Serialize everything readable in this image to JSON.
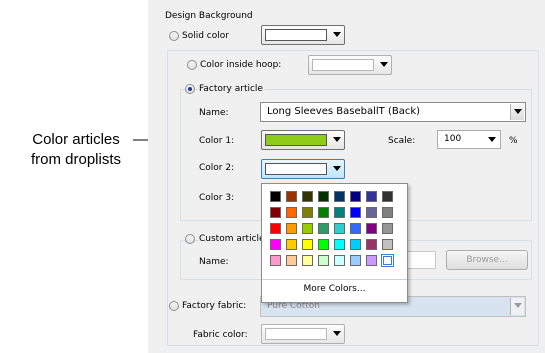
{
  "callout": {
    "line1": "Color articles",
    "line2": "from droplists"
  },
  "design_background": {
    "title": "Design Background",
    "solid_color_label": "Solid color",
    "color_inside_hoop_label": "Color inside hoop:",
    "factory_article": {
      "label": "Factory article",
      "name_label": "Name:",
      "name_value": "Long Sleeves BaseballT (Back)",
      "color1_label": "Color 1:",
      "color1_value": "#8fcc1a",
      "color2_label": "Color 2:",
      "color3_label": "Color 3:",
      "scale_label": "Scale:",
      "scale_value": "100",
      "scale_unit": "%"
    },
    "custom_article": {
      "label": "Custom article",
      "name_label": "Name:",
      "browse_label": "Browse..."
    },
    "factory_fabric": {
      "label": "Factory fabric:",
      "value": "Pure Cotton",
      "fabric_color_label": "Fabric color:"
    }
  },
  "palette": {
    "colors": [
      [
        "#000000",
        "#993300",
        "#333300",
        "#003300",
        "#003366",
        "#000080",
        "#333399",
        "#333333"
      ],
      [
        "#800000",
        "#ff6600",
        "#808000",
        "#008000",
        "#008080",
        "#0000ff",
        "#666699",
        "#808080"
      ],
      [
        "#ff0000",
        "#ff9900",
        "#99cc00",
        "#339966",
        "#33cccc",
        "#3366ff",
        "#800080",
        "#969696"
      ],
      [
        "#ff00ff",
        "#ffcc00",
        "#ffff00",
        "#00ff00",
        "#00ffff",
        "#00ccff",
        "#993366",
        "#c0c0c0"
      ],
      [
        "#ff99cc",
        "#ffcc99",
        "#ffff99",
        "#ccffcc",
        "#ccffff",
        "#99ccff",
        "#cc99ff",
        "#ffffff"
      ]
    ],
    "more_colors_label": "More Colors..."
  }
}
